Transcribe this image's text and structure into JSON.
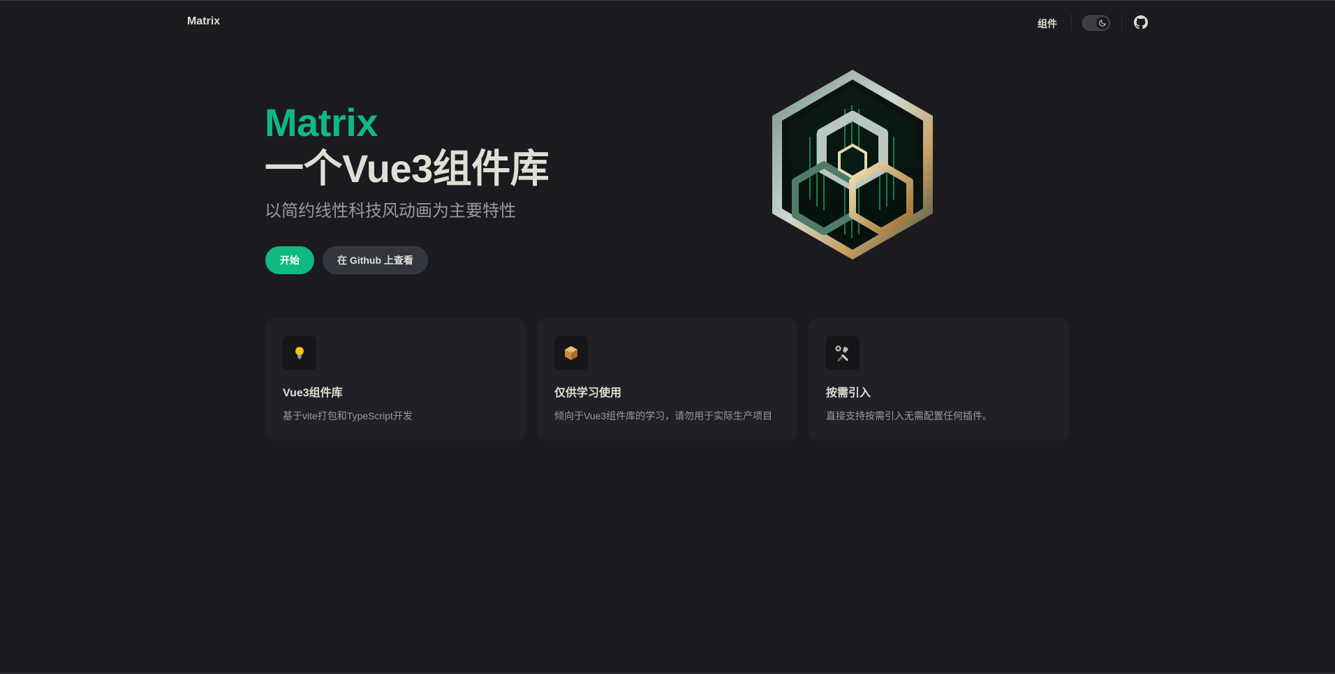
{
  "nav": {
    "brand": "Matrix",
    "link_components": "组件",
    "theme_toggle_icon": "moon-icon",
    "github_icon": "github-icon"
  },
  "hero": {
    "name": "Matrix",
    "text": "一个Vue3组件库",
    "tagline": "以简约线性科技风动画为主要特性",
    "actions": {
      "primary": "开始",
      "alt": "在 Github 上查看"
    },
    "image": "matrix-hexagon-logo"
  },
  "features": [
    {
      "icon": "💡",
      "title": "Vue3组件库",
      "details": "基于vite打包和TypeScript开发"
    },
    {
      "icon": "📦",
      "title": "仅供学习使用",
      "details": "倾向于Vue3组件库的学习，请勿用于实际生产项目"
    },
    {
      "icon": "🛠️",
      "title": "按需引入",
      "details": "直接支持按需引入无需配置任何插件。"
    }
  ],
  "colors": {
    "brand": "#10b981",
    "background": "#1b1b1f",
    "card": "#202127",
    "text": "#dfdfd6",
    "muted": "#98989f"
  }
}
